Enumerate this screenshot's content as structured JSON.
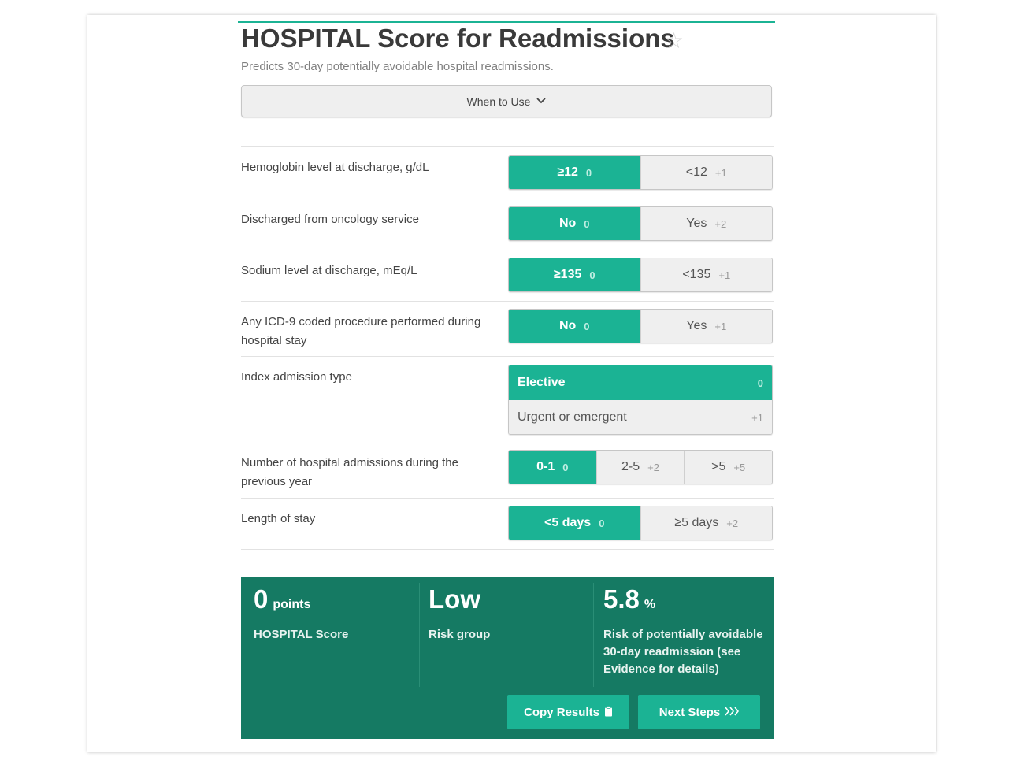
{
  "header": {
    "title": "HOSPITAL Score for Readmissions",
    "subtitle": "Predicts 30-day potentially avoidable hospital readmissions.",
    "when_to_use": "When to Use"
  },
  "questions": [
    {
      "label": "Hemoglobin level at discharge, g/dL",
      "options": [
        {
          "text": "≥12",
          "points": "0",
          "selected": true
        },
        {
          "text": "<12",
          "points": "+1",
          "selected": false
        }
      ]
    },
    {
      "label": "Discharged from oncology service",
      "options": [
        {
          "text": "No",
          "points": "0",
          "selected": true
        },
        {
          "text": "Yes",
          "points": "+2",
          "selected": false
        }
      ]
    },
    {
      "label": "Sodium level at discharge, mEq/L",
      "options": [
        {
          "text": "≥135",
          "points": "0",
          "selected": true
        },
        {
          "text": "<135",
          "points": "+1",
          "selected": false
        }
      ]
    },
    {
      "label": "Any ICD-9 coded procedure performed during hospital stay",
      "options": [
        {
          "text": "No",
          "points": "0",
          "selected": true
        },
        {
          "text": "Yes",
          "points": "+1",
          "selected": false
        }
      ]
    },
    {
      "label": "Index admission type",
      "options": [
        {
          "text": "Elective",
          "points": "0",
          "selected": true
        },
        {
          "text": "Urgent or emergent",
          "points": "+1",
          "selected": false
        }
      ]
    },
    {
      "label": "Number of hospital admissions during the previous year",
      "options": [
        {
          "text": "0-1",
          "points": "0",
          "selected": true
        },
        {
          "text": "2-5",
          "points": "+2",
          "selected": false
        },
        {
          "text": ">5",
          "points": "+5",
          "selected": false
        }
      ]
    },
    {
      "label": "Length of stay",
      "options": [
        {
          "text": "<5 days",
          "points": "0",
          "selected": true
        },
        {
          "text": "≥5 days",
          "points": "+2",
          "selected": false
        }
      ]
    }
  ],
  "result": {
    "score_value": "0",
    "score_unit": "points",
    "score_label": "HOSPITAL Score",
    "risk_value": "Low",
    "risk_label": "Risk group",
    "pct_value": "5.8",
    "pct_unit": "%",
    "pct_label": "Risk of potentially avoidable 30-day readmission (see Evidence for details)",
    "copy_button": "Copy Results",
    "next_button": "Next Steps"
  },
  "icons": {
    "favorite": "star-outline-icon",
    "expand": "chevron-down-icon",
    "copy": "clipboard-icon",
    "next": "triple-chevron-right-icon"
  },
  "colors": {
    "accent": "#1bb394",
    "result_bg": "#157a63"
  }
}
